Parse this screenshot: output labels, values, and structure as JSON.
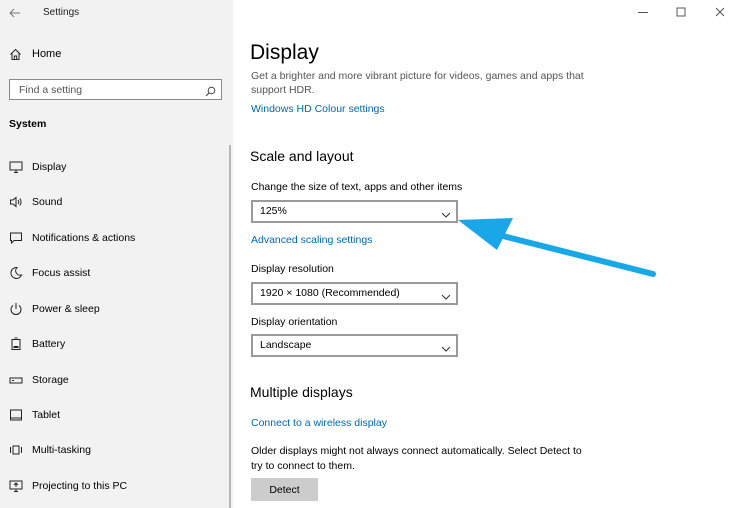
{
  "window": {
    "title": "Settings"
  },
  "sidebar": {
    "home_label": "Home",
    "search": {
      "placeholder": "Find a setting",
      "value": ""
    },
    "section_title": "System",
    "items": [
      {
        "label": "Display",
        "icon": "monitor-icon"
      },
      {
        "label": "Sound",
        "icon": "speaker-icon"
      },
      {
        "label": "Notifications & actions",
        "icon": "message-icon"
      },
      {
        "label": "Focus assist",
        "icon": "moon-icon"
      },
      {
        "label": "Power & sleep",
        "icon": "power-icon"
      },
      {
        "label": "Battery",
        "icon": "battery-icon"
      },
      {
        "label": "Storage",
        "icon": "storage-icon"
      },
      {
        "label": "Tablet",
        "icon": "tablet-icon"
      },
      {
        "label": "Multi-tasking",
        "icon": "multitask-icon"
      },
      {
        "label": "Projecting to this PC",
        "icon": "project-icon"
      }
    ]
  },
  "main": {
    "title": "Display",
    "description": "Get a brighter and more vibrant picture for videos, games and apps that support HDR.",
    "hdr_link": "Windows HD Colour settings",
    "scale_section": {
      "heading": "Scale and layout",
      "size_label": "Change the size of text, apps and other items",
      "size_value": "125%",
      "advanced_link": "Advanced scaling settings",
      "resolution_label": "Display resolution",
      "resolution_value": "1920 × 1080 (Recommended)",
      "orientation_label": "Display orientation",
      "orientation_value": "Landscape"
    },
    "multiple_section": {
      "heading": "Multiple displays",
      "wireless_link": "Connect to a wireless display",
      "note": "Older displays might not always connect automatically. Select Detect to try to connect to them.",
      "detect_button": "Detect"
    }
  },
  "colors": {
    "accent": "#0067b8",
    "sidebar_bg": "#f2f2f2",
    "annotation_arrow": "#1aa7e8"
  }
}
